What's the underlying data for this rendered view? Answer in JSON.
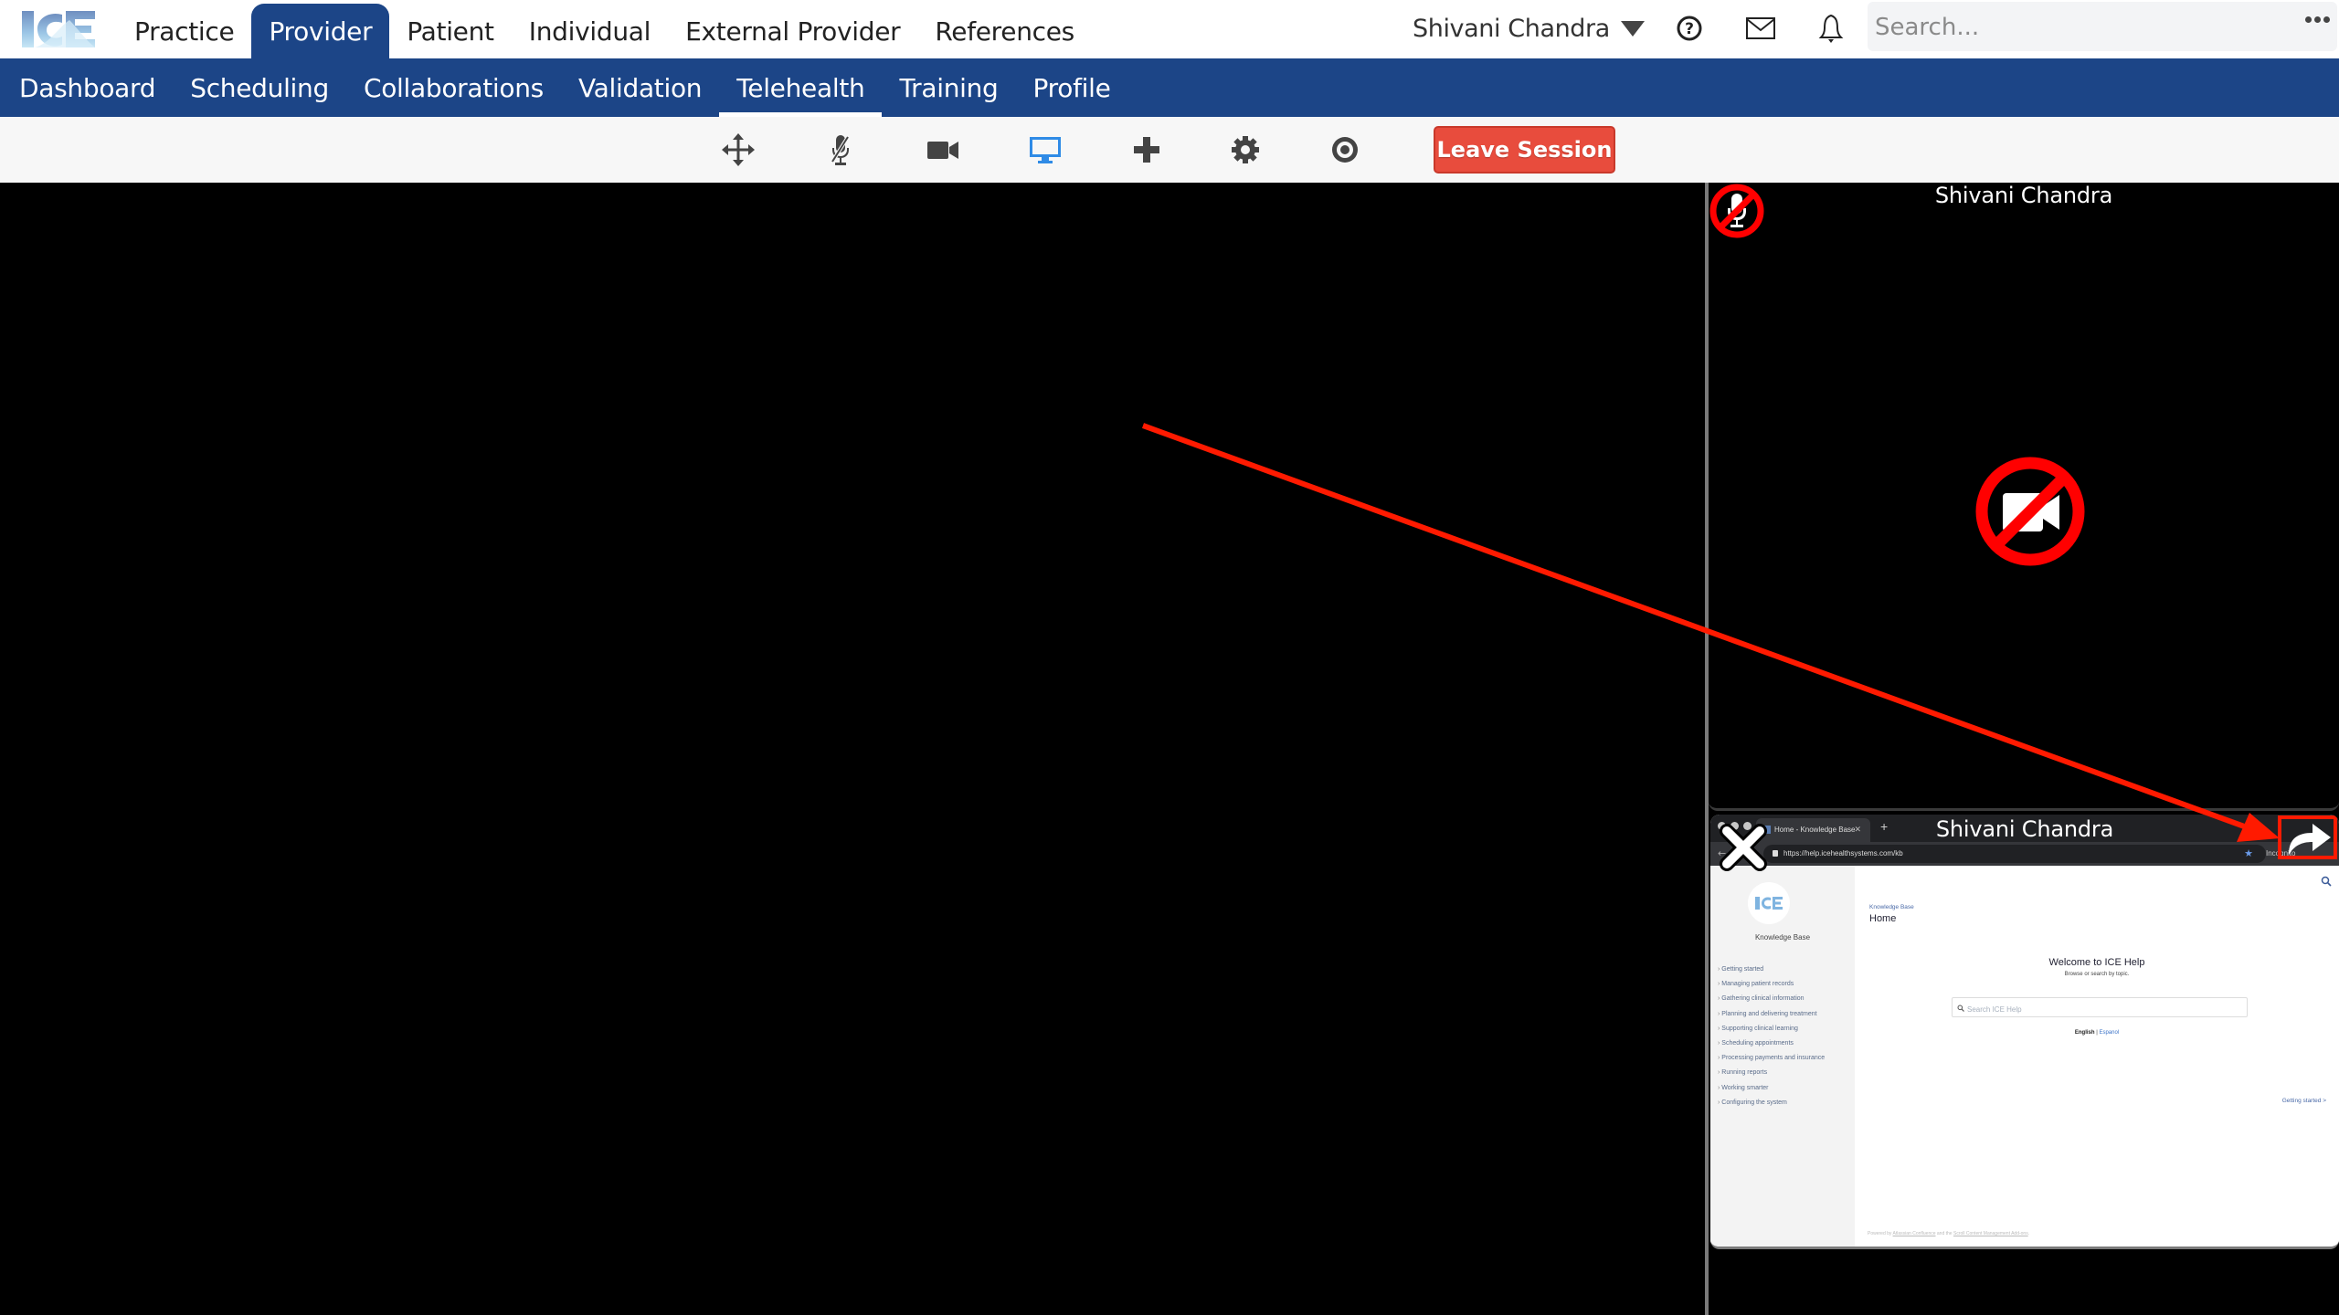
{
  "header": {
    "logo_alt": "ICE",
    "main_nav": [
      {
        "label": "Practice",
        "active": false
      },
      {
        "label": "Provider",
        "active": true
      },
      {
        "label": "Patient",
        "active": false
      },
      {
        "label": "Individual",
        "active": false
      },
      {
        "label": "External Provider",
        "active": false
      },
      {
        "label": "References",
        "active": false
      }
    ],
    "user_name": "Shivani Chandra",
    "icons": [
      "help-icon",
      "mail-icon",
      "bell-icon"
    ],
    "search_placeholder": "Search...",
    "search_value": ""
  },
  "sub_nav": [
    {
      "label": "Dashboard",
      "active": false
    },
    {
      "label": "Scheduling",
      "active": false
    },
    {
      "label": "Collaborations",
      "active": false
    },
    {
      "label": "Validation",
      "active": false
    },
    {
      "label": "Telehealth",
      "active": true
    },
    {
      "label": "Training",
      "active": false
    },
    {
      "label": "Profile",
      "active": false
    }
  ],
  "toolbar": {
    "tools": [
      "move-icon",
      "microphone-muted-icon",
      "camera-icon",
      "screen-share-icon",
      "add-icon",
      "settings-icon",
      "record-icon"
    ],
    "active_tool": "screen-share-icon",
    "leave_label": "Leave Session"
  },
  "participants": {
    "camera_tile": {
      "name": "Shivani Chandra",
      "mic_muted": true,
      "camera_off": true
    },
    "share_tile": {
      "name": "Shivani Chandra",
      "shared_screen": {
        "browser_tab": "Home - Knowledge Base",
        "url": "https://help.icehealthsystems.com/kb",
        "incognito_label": "Incognito",
        "sidebar_title": "Knowledge Base",
        "sidebar_items": [
          "Getting started",
          "Managing patient records",
          "Gathering clinical information",
          "Planning and delivering treatment",
          "Supporting clinical learning",
          "Scheduling appointments",
          "Processing payments and insurance",
          "Running reports",
          "Working smarter",
          "Configuring the system"
        ],
        "breadcrumb": "Knowledge Base",
        "page_title": "Home",
        "welcome": "Welcome to ICE Help",
        "subtitle": "Browse or search by topic.",
        "search_placeholder": "Search ICE Help",
        "lang_english": "English",
        "lang_separator": "|",
        "lang_spanish": "Espanol",
        "next_link": "Getting started >",
        "footer_prefix": "Powered by",
        "footer_link1": "Atlassian Confluence",
        "footer_mid": "and the",
        "footer_link2": "Scroll Content Management Add-ons",
        "footer_suffix": "."
      }
    }
  },
  "colors": {
    "brand_blue": "#1c4587",
    "leave_red": "#e84c3d",
    "active_tool_blue": "#2f8be6",
    "annotation_red": "#ff1a00"
  }
}
